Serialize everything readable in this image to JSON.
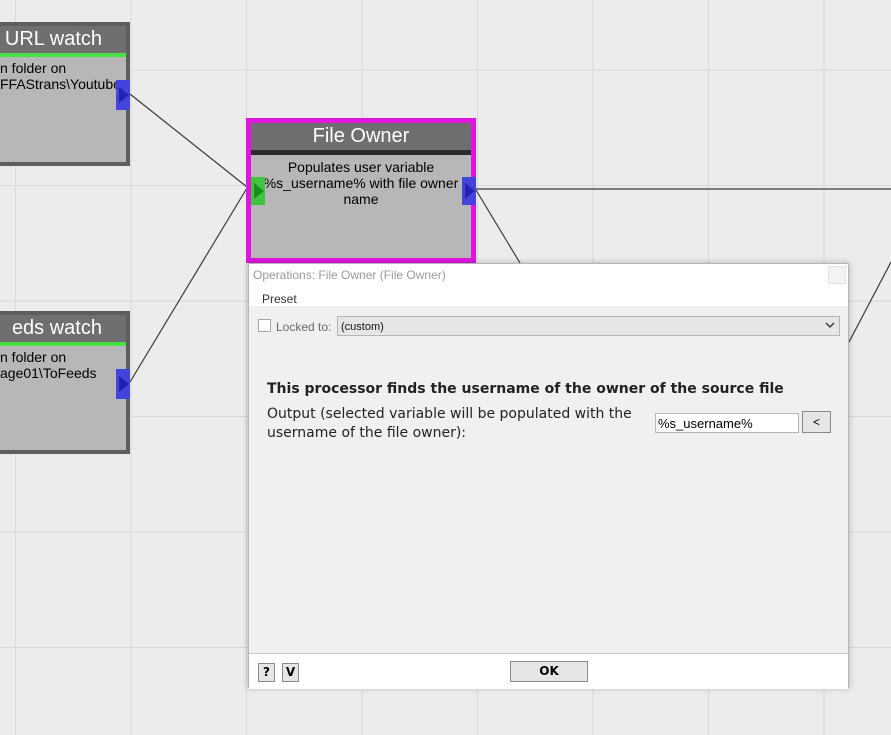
{
  "nodes": {
    "url_watch": {
      "title": "URL watch",
      "desc_line1": "n folder on",
      "desc_line2": "FFAStrans\\Youtube"
    },
    "feeds_watch": {
      "title": "eds watch",
      "desc_line1": "n folder on",
      "desc_line2": "age01\\ToFeeds"
    },
    "file_owner": {
      "title": "File Owner",
      "desc": "Populates user variable %s_username% with file owner name"
    }
  },
  "dialog": {
    "title": "Operations: File Owner (File Owner)",
    "menu_preset": "Preset",
    "locked_label": "Locked to:",
    "locked_value": "(custom)",
    "heading": "This processor finds the username of the owner of the source file",
    "output_label": "Output (selected variable will be populated with the username of the file owner):",
    "output_value": "%s_username%",
    "var_button": "<",
    "help_button": "?",
    "v_button": "V",
    "ok_button": "OK"
  },
  "colors": {
    "selection": "#e016e0",
    "port_out": "#4444dd",
    "port_in": "#3ec63e",
    "status_bar": "#47e047"
  },
  "icons": {
    "dropdown": "chevron-down-icon",
    "close": "close-icon"
  }
}
